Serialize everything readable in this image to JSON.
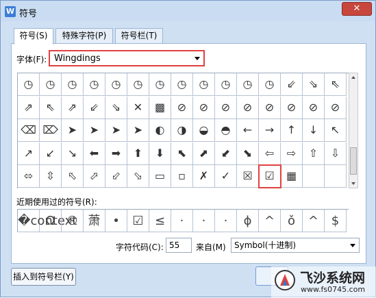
{
  "window": {
    "title": "符号",
    "app_icon": "W",
    "close": "✕"
  },
  "tabs": [
    {
      "label": "符号(S)",
      "active": true
    },
    {
      "label": "特殊字符(P)",
      "active": false
    },
    {
      "label": "符号栏(T)",
      "active": false
    }
  ],
  "font": {
    "label": "字体(F):",
    "value": "Wingdings"
  },
  "symbol_grid": [
    [
      "◷",
      "◷",
      "◷",
      "◷",
      "◷",
      "◷",
      "◷",
      "◷",
      "◷",
      "◷",
      "◷",
      "◷",
      "⇙",
      "⇘",
      "⇖"
    ],
    [
      "⇗",
      "⇖",
      "⇗",
      "⇙",
      "⇘",
      "✕",
      "▩",
      "⊘",
      "⊘",
      "⊘",
      "⊘",
      "⊘",
      "⊘",
      "⊘",
      "⊘"
    ],
    [
      "⌫",
      "⌦",
      "➤",
      "➤",
      "➤",
      "➤",
      "◐",
      "◑",
      "◒",
      "◓",
      "←",
      "→",
      "↑",
      "↓",
      "↖"
    ],
    [
      "↗",
      "↙",
      "↘",
      "⬅",
      "➡",
      "⬆",
      "⬇",
      "⬉",
      "⬈",
      "⬋",
      "⬊",
      "⇦",
      "⇨",
      "⇧",
      "⇩"
    ],
    [
      "⬄",
      "⇳",
      "⬁",
      "⬀",
      "⬃",
      "⬂",
      "▭",
      "▫",
      "✗",
      "✓",
      "☒",
      "☑",
      "▦",
      "",
      ""
    ]
  ],
  "recent": {
    "label": "近期使用过的符号(R):",
    "symbols": [
      "�context",
      "Ω",
      "®",
      "萧",
      "•",
      "☑",
      "≤",
      "·",
      "·",
      "·",
      "ϕ",
      "^",
      "ǒ",
      "^",
      "$"
    ]
  },
  "code": {
    "label": "字符代码(C):",
    "value": "55",
    "from_label": "来自(M)",
    "from_value": "Symbol(十进制)"
  },
  "buttons": {
    "insert": "插入到符号栏(Y)"
  },
  "watermark": {
    "title": "飞沙系统网",
    "url": "www.fs0745.com"
  },
  "colors": {
    "highlight": "#e04040",
    "titlebar": "#c9dcf2",
    "accent": "#3c7ed6"
  }
}
